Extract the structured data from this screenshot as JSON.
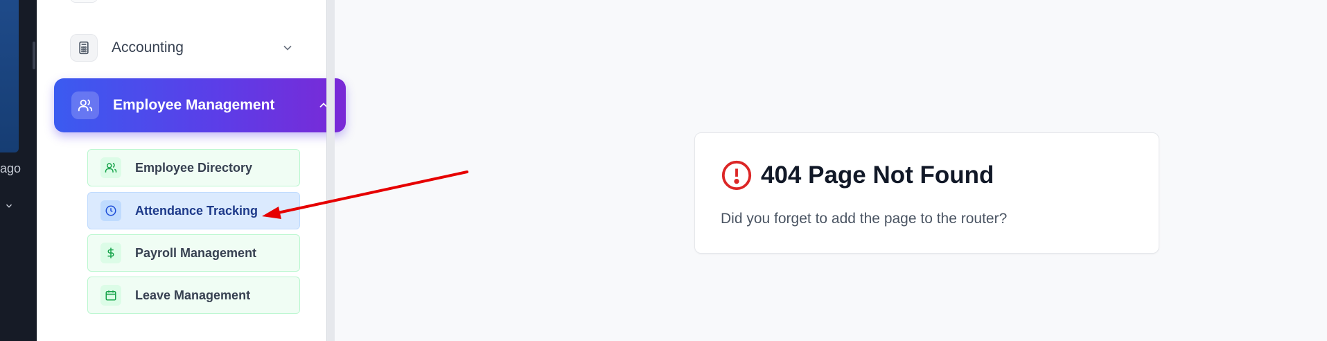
{
  "left_strip": {
    "time_suffix": "ago"
  },
  "sidebar": {
    "accounting": {
      "label": "Accounting",
      "icon": "calculator-icon"
    },
    "employee_management": {
      "label": "Employee Management",
      "icon": "users-icon",
      "expanded": true
    },
    "sub_items": [
      {
        "label": "Employee Directory",
        "icon": "users-icon"
      },
      {
        "label": "Attendance Tracking",
        "icon": "clock-icon",
        "active": true
      },
      {
        "label": "Payroll Management",
        "icon": "dollar-icon"
      },
      {
        "label": "Leave Management",
        "icon": "calendar-icon"
      }
    ]
  },
  "main": {
    "error_title": "404 Page Not Found",
    "error_message": "Did you forget to add the page to the router?"
  },
  "colors": {
    "accent_gradient_start": "#3b5bf0",
    "accent_gradient_end": "#7a29d6",
    "error_red": "#dc2626",
    "annotation_arrow": "#e60000"
  }
}
